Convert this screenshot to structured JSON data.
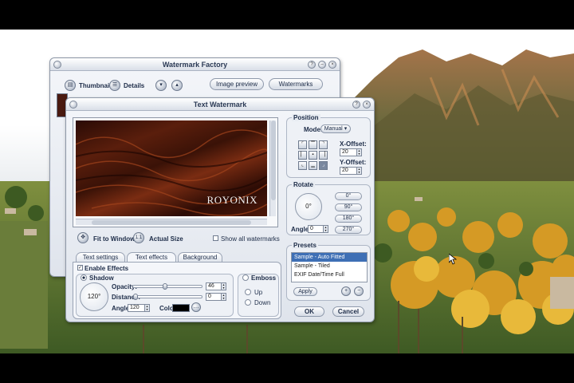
{
  "main_window": {
    "title": "Watermark Factory",
    "view_thumbnails": "Thumbnails",
    "view_details": "Details",
    "tab_image_preview": "Image preview",
    "tab_watermarks": "Watermarks"
  },
  "dialog": {
    "title": "Text Watermark",
    "preview_text": "ROYONIX",
    "fit_to_window": "Fit to Window",
    "actual_size": "Actual Size",
    "actual_size_icon": "1:1",
    "show_all_watermarks": "Show all watermarks",
    "tabs": [
      "Text settings",
      "Text effects",
      "Background"
    ],
    "enable_effects": "Enable Effects",
    "shadow": {
      "label": "Shadow",
      "dial_value": "120°",
      "opacity_label": "Opacity:",
      "opacity_value": "46",
      "opacity_fraction": 0.46,
      "distance_label": "Distance:",
      "distance_value": "0",
      "angle_label": "Angle:",
      "angle_value": "120",
      "color_label": "Color:",
      "color": "#000000"
    },
    "emboss": {
      "label": "Emboss",
      "up": "Up",
      "down": "Down"
    },
    "position": {
      "title": "Position",
      "mode_label": "Mode:",
      "mode_value": "Manual",
      "x_offset_label": "X-Offset:",
      "x_offset_value": "20",
      "y_offset_label": "Y-Offset:",
      "y_offset_value": "20"
    },
    "rotate": {
      "title": "Rotate",
      "dial_value": "0°",
      "angle_label": "Angle:",
      "angle_value": "0",
      "presets": [
        "0°",
        "90°",
        "180°",
        "270°"
      ]
    },
    "presets": {
      "title": "Presets",
      "items": [
        "Sample - Auto Fitted",
        "Sample - Tiled",
        "EXIF Date/Time Full"
      ],
      "selected_index": 0,
      "apply": "Apply"
    },
    "ok": "OK",
    "cancel": "Cancel"
  },
  "colors": {
    "selection": "#3e6fb5",
    "title_text": "#2b3a55"
  }
}
